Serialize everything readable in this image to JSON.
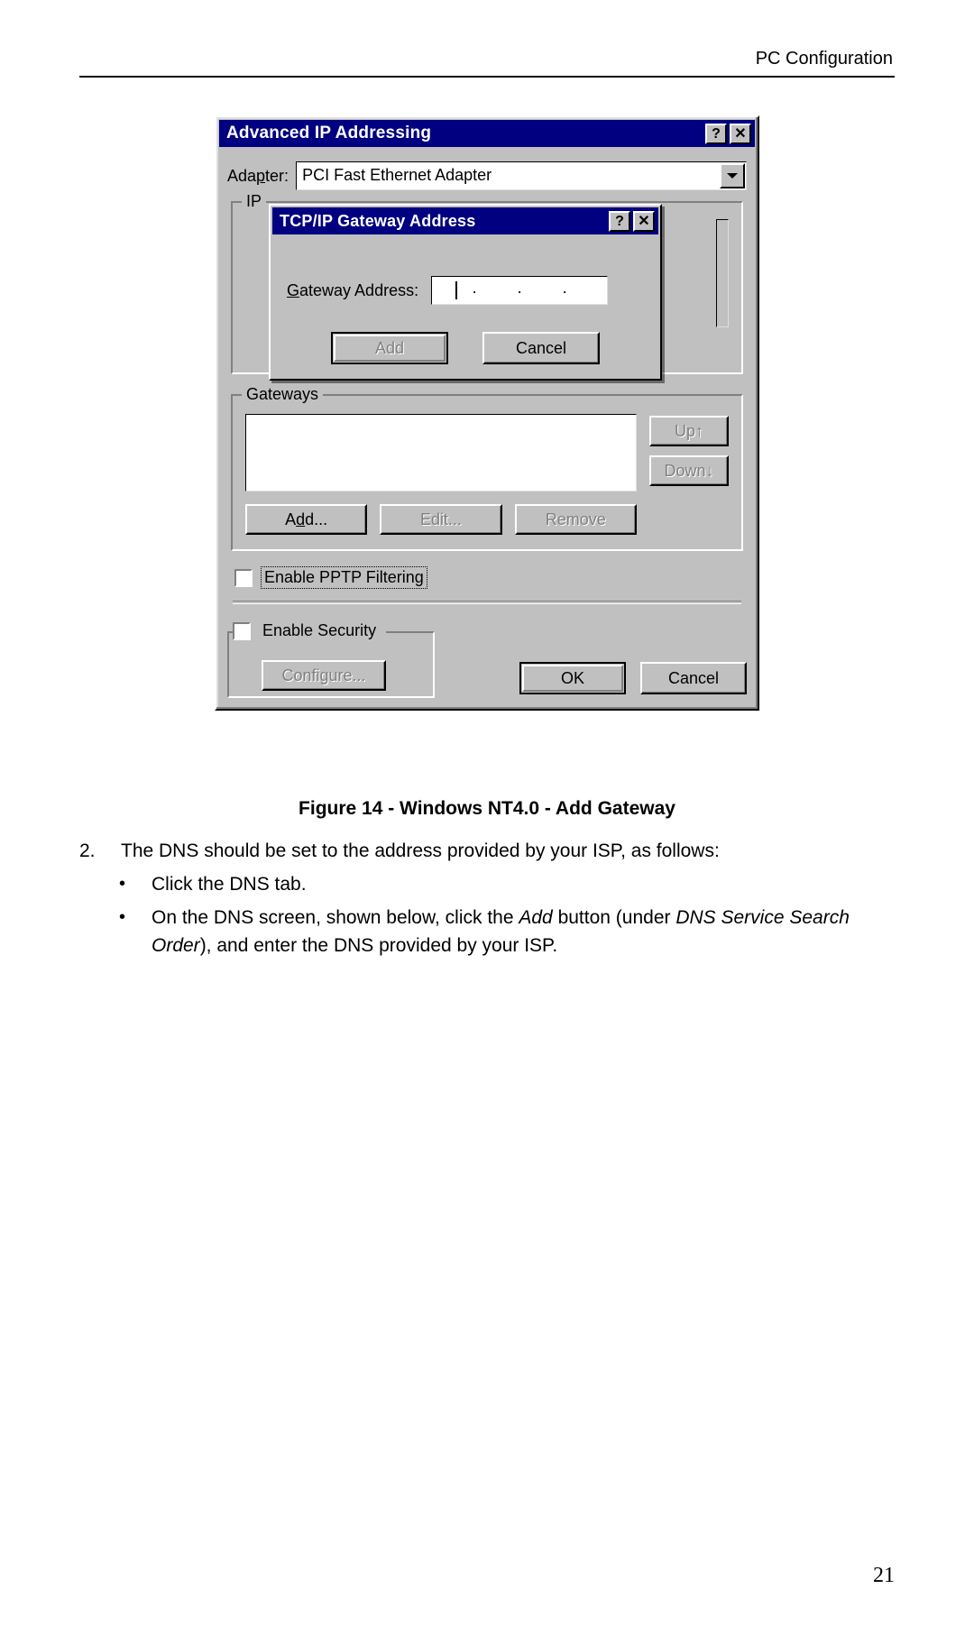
{
  "page": {
    "header_title": "PC Configuration",
    "page_number": "21"
  },
  "figure": {
    "caption": "Figure 14 - Windows NT4.0 - Add Gateway"
  },
  "dialog": {
    "title": "Advanced IP Addressing",
    "help_button": "?",
    "close_button": "✕",
    "adapter": {
      "label": "Adapter:",
      "label_accel": "p",
      "value": "PCI Fast Ethernet Adapter"
    },
    "ip_group": {
      "legend": "IP"
    },
    "gateways_group": {
      "legend": "Gateways",
      "legend_accel": "G",
      "list_items": [],
      "up_button": "Up↑",
      "down_button": "Down↓",
      "add_button": "Add...",
      "edit_button": "Edit...",
      "remove_button": "Remove"
    },
    "pptp": {
      "label": "Enable PPTP Filtering",
      "checked": false
    },
    "security": {
      "label": "Enable Security",
      "checked": false,
      "configure_button": "Configure..."
    },
    "ok_button": "OK",
    "cancel_button": "Cancel"
  },
  "inner_dialog": {
    "title": "TCP/IP Gateway Address",
    "help_button": "?",
    "close_button": "✕",
    "gateway_label": "Gateway Address:",
    "gateway_label_accel": "G",
    "gateway_octets": [
      "",
      "",
      "",
      ""
    ],
    "gateway_dot": ".",
    "add_button": "Add",
    "cancel_button": "Cancel"
  },
  "body": {
    "step_number": "2.",
    "step_text": "The DNS should be set to the address provided by your ISP, as follows:",
    "bullet_marker": "•",
    "bullet1": "Click the DNS tab.",
    "bullet2_part1": "On the DNS screen, shown below, click the ",
    "bullet2_em1": "Add",
    "bullet2_part2": " button (under ",
    "bullet2_em2": "DNS Service Search Order",
    "bullet2_part3": "), and enter the DNS provided by your ISP."
  }
}
